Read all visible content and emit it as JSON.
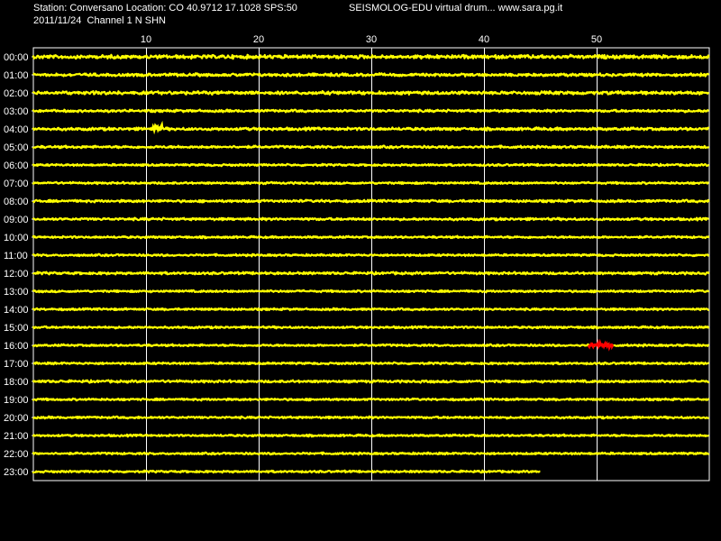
{
  "header": {
    "station_line": "Station: Conversano Location: CO 40.9712 17.1028 SPS:50",
    "date_line": "2011/11/24  Channel 1 N SHN",
    "source_line": "SEISMOLOG-EDU virtual drum... www.sara.pg.it"
  },
  "colors": {
    "background": "#000000",
    "trace": "#ffff00",
    "event": "#ff0000",
    "grid": "#ffffff",
    "text": "#ffffff"
  },
  "chart_data": {
    "type": "line",
    "xlim": [
      0,
      60
    ],
    "x_ticks": [
      10,
      20,
      30,
      40,
      50
    ],
    "hours": [
      "00:00",
      "01:00",
      "02:00",
      "03:00",
      "04:00",
      "05:00",
      "06:00",
      "07:00",
      "08:00",
      "09:00",
      "10:00",
      "11:00",
      "12:00",
      "13:00",
      "14:00",
      "15:00",
      "16:00",
      "17:00",
      "18:00",
      "19:00",
      "20:00",
      "21:00",
      "22:00",
      "23:00"
    ],
    "trace_end_minute": [
      60,
      60,
      60,
      60,
      60,
      60,
      60,
      60,
      60,
      60,
      60,
      60,
      60,
      60,
      60,
      60,
      60,
      60,
      60,
      60,
      60,
      60,
      60,
      45
    ],
    "trace_amplitude": [
      0.9,
      0.7,
      0.8,
      0.6,
      0.7,
      0.6,
      0.5,
      0.5,
      0.6,
      0.6,
      0.5,
      0.5,
      0.6,
      0.5,
      0.5,
      0.5,
      0.5,
      0.5,
      0.6,
      0.5,
      0.5,
      0.5,
      0.5,
      0.5
    ],
    "events": [
      {
        "hour": "04:00",
        "start_minute": 10.5,
        "end_minute": 11.5,
        "amplitude": 2.2,
        "color": "#ffff00"
      },
      {
        "hour": "16:00",
        "start_minute": 49.3,
        "end_minute": 51.5,
        "amplitude": 1.1,
        "color": "#ff0000"
      }
    ],
    "grid": true
  }
}
